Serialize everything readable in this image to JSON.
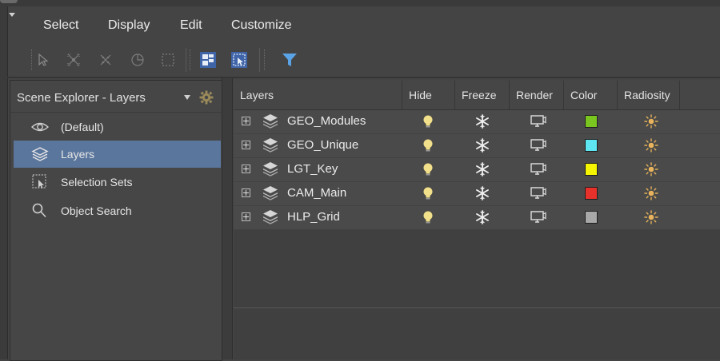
{
  "menu": {
    "items": [
      {
        "label": "Select"
      },
      {
        "label": "Display"
      },
      {
        "label": "Edit"
      },
      {
        "label": "Customize"
      }
    ]
  },
  "toolbar": {
    "buttons": [
      {
        "icon": "select-cursor-icon"
      },
      {
        "icon": "select-children-icon"
      },
      {
        "icon": "select-dependents-icon"
      },
      {
        "icon": "select-influences-icon"
      },
      {
        "icon": "region-select-icon"
      },
      {
        "icon": "layer-hierarchy-icon"
      },
      {
        "icon": "selection-region-icon"
      },
      {
        "icon": "filter-icon"
      }
    ]
  },
  "panel": {
    "title": "Scene Explorer - Layers",
    "items": [
      {
        "label": "(Default)",
        "icon": "eye-icon",
        "active": false
      },
      {
        "label": "Layers",
        "icon": "layers-icon",
        "active": true
      },
      {
        "label": "Selection Sets",
        "icon": "selection-set-icon",
        "active": false
      },
      {
        "label": "Object Search",
        "icon": "search-icon",
        "active": false
      }
    ]
  },
  "grid": {
    "columns": [
      {
        "label": "Layers"
      },
      {
        "label": "Hide"
      },
      {
        "label": "Freeze"
      },
      {
        "label": "Render"
      },
      {
        "label": "Color"
      },
      {
        "label": "Radiosity"
      }
    ],
    "rows": [
      {
        "name": "GEO_Modules",
        "color": "#7ac520"
      },
      {
        "name": "GEO_Unique",
        "color": "#5ee6f2"
      },
      {
        "name": "LGT_Key",
        "color": "#f5f500"
      },
      {
        "name": "CAM_Main",
        "color": "#e8312a"
      },
      {
        "name": "HLP_Grid",
        "color": "#a8a8a8"
      }
    ]
  },
  "colors": {
    "accent": "#5b769d",
    "toolbar_button": "#3f64a8",
    "filter": "#5aa3e6",
    "bulb": "#f3e08a",
    "sun": "#e8b35a"
  }
}
